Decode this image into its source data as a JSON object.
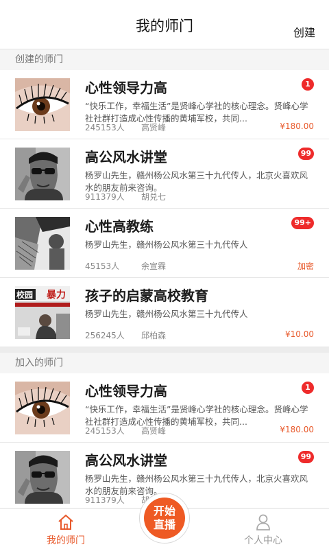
{
  "header": {
    "title": "我的师门",
    "action_label": "创建"
  },
  "created_section": {
    "title": "创建的师门",
    "items": [
      {
        "name": "心性领导力高",
        "desc": "“快乐工作，幸福生活”是贤峰心学社的核心理念。贤峰心学社社群打造成心性传播的黄埔军校，共同...",
        "members": "245153人",
        "owner": "高贤峰",
        "price": "¥180.00",
        "badge": "1",
        "thumb": "eye-icon"
      },
      {
        "name": "高公风水讲堂",
        "desc": "杨罗山先生，赣州杨公风水第三十九代传人，北京火喜欢风水的朋友前来咨询。",
        "members": "911379人",
        "owner": "胡兑七",
        "price": "",
        "badge": "99",
        "thumb": "man-sunglasses"
      },
      {
        "name": "心性高教练",
        "desc": "杨罗山先生，赣州杨公风水第三十九代传人",
        "members": "45153人",
        "owner": "余宣霖",
        "price": "加密",
        "badge": "99+",
        "thumb": "boy-feathers"
      },
      {
        "name": "孩子的启蒙高校教育",
        "desc": "杨罗山先生，赣州杨公风水第三十九代传人",
        "members": "256245人",
        "owner": "邱柏森",
        "price": "¥10.00",
        "badge": "",
        "thumb": "violence-poster"
      }
    ]
  },
  "joined_section": {
    "title": "加入的师门",
    "items": [
      {
        "name": "心性领导力高",
        "desc": "“快乐工作，幸福生活”是贤峰心学社的核心理念。贤峰心学社社群打造成心性传播的黄埔军校，共同...",
        "members": "245153人",
        "owner": "高贤峰",
        "price": "¥180.00",
        "badge": "1",
        "thumb": "eye-icon"
      },
      {
        "name": "高公风水讲堂",
        "desc": "杨罗山先生，赣州杨公风水第三十九代传人，北京火喜欢风水的朋友前来咨询。",
        "members": "911379人",
        "owner": "胡兑七",
        "price": "",
        "badge": "99",
        "thumb": "man-sunglasses"
      }
    ]
  },
  "thumb_poster_text": {
    "top": "暴力",
    "left": "校园"
  },
  "tabbar": {
    "home_label": "我的师门",
    "live_label_1": "开始",
    "live_label_2": "直播",
    "profile_label": "个人中心"
  },
  "colors": {
    "accent": "#e85a2c",
    "badge": "#ee2b2b",
    "live": "#ee5a24"
  }
}
